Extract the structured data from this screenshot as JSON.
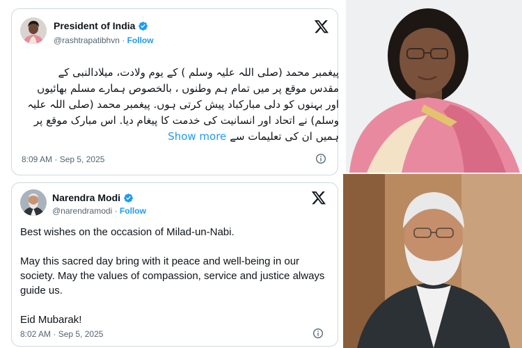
{
  "tweets": [
    {
      "author": "President of India",
      "handle": "@rashtrapatibhvn",
      "separator": "·",
      "follow_label": "Follow",
      "text": "پیغمبر محمد (صلی اللہ علیہ وسلم ) کے یوم ولادت، میلادالنبی کے مقدس موقع پر میں تمام ہم وطنوں ، بالخصوص ہمارے مسلم بھائیوں اور بہنوں کو دلی مبارکباد پیش کرتی ہوں. پیغمبر محمد (صلی اللہ علیہ وسلم) نے اتحاد اور انسانیت کی خدمت کا پیغام دیا. اس مبارک موقع پر ہمیں ان کی تعلیمات سے",
      "show_more_label": "Show more",
      "timestamp": "8:09 AM · Sep 5, 2025"
    },
    {
      "author": "Narendra Modi",
      "handle": "@narendramodi",
      "separator": "·",
      "follow_label": "Follow",
      "paragraphs": [
        "Best wishes on the occasion of Milad-un-Nabi.",
        "May this sacred day bring with it peace and well-being in our society. May the values of compassion, service and justice always guide us.",
        "Eid Mubarak!"
      ],
      "timestamp": "8:02 AM · Sep 5, 2025"
    }
  ],
  "colors": {
    "link": "#1d9bf0",
    "text": "#0f1419",
    "muted": "#536471",
    "border": "#cfd9de",
    "saree_pink": "#e9899f"
  },
  "icons": [
    "verified-badge-icon",
    "x-logo-icon",
    "info-icon"
  ]
}
